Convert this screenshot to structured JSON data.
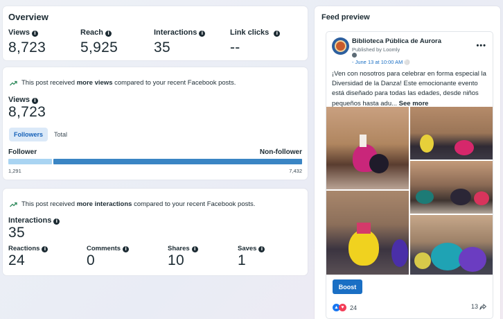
{
  "overview": {
    "title": "Overview",
    "metrics": [
      {
        "label": "Views",
        "value": "8,723"
      },
      {
        "label": "Reach",
        "value": "5,925"
      },
      {
        "label": "Interactions",
        "value": "35"
      },
      {
        "label": "Link clicks",
        "value": "--"
      }
    ]
  },
  "views_card": {
    "trend_prefix": "This post received ",
    "trend_bold": "more views",
    "trend_suffix": " compared to your recent Facebook posts.",
    "label": "Views",
    "value": "8,723",
    "tabs": [
      "Followers",
      "Total"
    ],
    "active_tab": "Followers",
    "follower_label": "Follower",
    "nonfollower_label": "Non-follower",
    "follower_count": "1,291",
    "nonfollower_count": "7,432",
    "follower_share": 0.148,
    "colors": {
      "follower": "#a9d4f2",
      "nonfollower": "#3a85c4"
    }
  },
  "interactions_card": {
    "trend_prefix": "This post received ",
    "trend_bold": "more interactions",
    "trend_suffix": " compared to your recent Facebook posts.",
    "label": "Interactions",
    "value": "35",
    "metrics": [
      {
        "label": "Reactions",
        "value": "24"
      },
      {
        "label": "Comments",
        "value": "0"
      },
      {
        "label": "Shares",
        "value": "10"
      },
      {
        "label": "Saves",
        "value": "1"
      }
    ]
  },
  "feed": {
    "title": "Feed preview",
    "page_name": "Biblioteca Pública de Aurora",
    "published_by": "Published by Loomly",
    "date": "June 13 at 10:00 AM",
    "text": "¡Ven con nosotros para celebrar en forma especial la Diversidad de la Danza! Este emocionante evento está diseñado para todas las edades, desde niños pequeños hasta adu...",
    "see_more": "See more",
    "boost": "Boost",
    "reaction_count": "24",
    "share_count": "13",
    "more_icon": "more-options-icon"
  }
}
